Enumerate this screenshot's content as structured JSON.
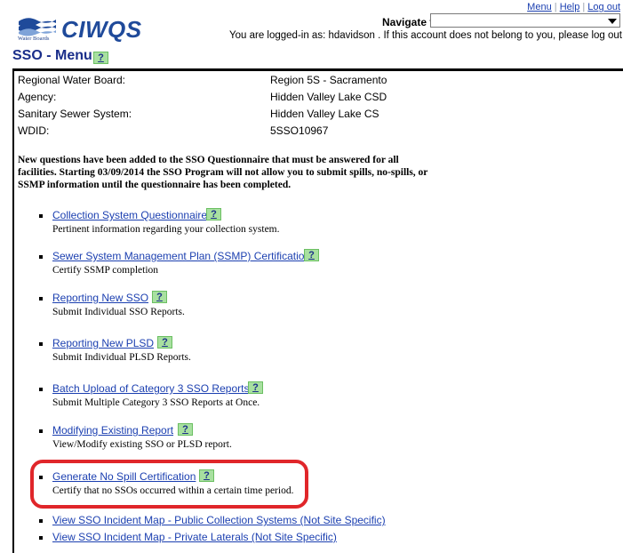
{
  "header": {
    "logo_name": "CIWQS",
    "logo_caption": "Water Boards",
    "links": [
      "Menu",
      "Help",
      "Log out"
    ],
    "navigate_label": "Navigate to:",
    "navigate_value": "",
    "logged_in_text": "You are logged-in as: hdavidson . If this account does not belong to you, please log out."
  },
  "page": {
    "title": "SSO - Menu",
    "help_glyph": "?"
  },
  "info": [
    {
      "label": "Regional Water Board:",
      "value": "Region 5S - Sacramento"
    },
    {
      "label": "Agency:",
      "value": "Hidden Valley Lake CSD"
    },
    {
      "label": "Sanitary Sewer System:",
      "value": "Hidden Valley Lake CS"
    },
    {
      "label": "WDID:",
      "value": "5SSO10967"
    }
  ],
  "notice": "New questions have been added to the SSO Questionnaire that must be answered for all facilities. Starting 03/09/2014 the SSO Program will not allow you to submit spills, no-spills, or SSMP information until the questionnaire has been completed.",
  "menu": [
    {
      "link": "Collection System Questionnaire",
      "desc": "Pertinent information regarding your collection system."
    },
    {
      "link": "Sewer System Management Plan (SSMP) Certification",
      "desc": "Certify SSMP completion"
    },
    {
      "link": "Reporting New SSO",
      "desc": "Submit Individual SSO Reports."
    },
    {
      "link": "Reporting New PLSD",
      "desc": "Submit Individual PLSD Reports."
    },
    {
      "link": "Batch Upload of Category 3 SSO Reports",
      "desc": "Submit Multiple Category 3 SSO Reports at Once."
    },
    {
      "link": "Modifying Existing Report",
      "desc": "View/Modify existing SSO or PLSD report."
    },
    {
      "link": "Generate No Spill Certification",
      "desc": "Certify that no SSOs occurred within a certain time period."
    },
    {
      "link": "View SSO Incident Map - Public Collection Systems (Not Site Specific)"
    },
    {
      "link": "View SSO Incident Map - Private Laterals (Not Site Specific)"
    }
  ],
  "colors": {
    "link": "#1b3fb0",
    "title": "#1a2e8a",
    "help_bg": "#a8e0a0",
    "highlight": "#e0262a"
  }
}
